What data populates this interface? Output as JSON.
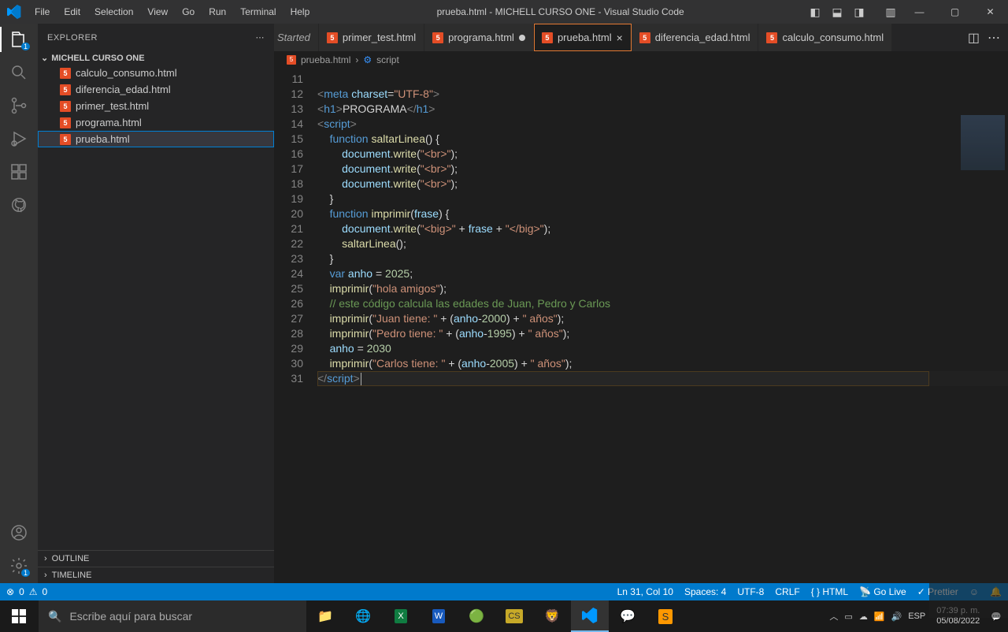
{
  "titlebar": {
    "menus": [
      "File",
      "Edit",
      "Selection",
      "View",
      "Go",
      "Run",
      "Terminal",
      "Help"
    ],
    "title": "prueba.html - MICHELL CURSO ONE - Visual Studio Code"
  },
  "sidebar": {
    "title": "EXPLORER",
    "folder": "MICHELL CURSO ONE",
    "files": [
      "calculo_consumo.html",
      "diferencia_edad.html",
      "primer_test.html",
      "programa.html",
      "prueba.html"
    ],
    "selected_index": 4,
    "outline": "OUTLINE",
    "timeline": "TIMELINE"
  },
  "tabs": {
    "partial": "Started",
    "items": [
      {
        "label": "primer_test.html",
        "dirty": false,
        "active": false
      },
      {
        "label": "programa.html",
        "dirty": true,
        "active": false
      },
      {
        "label": "prueba.html",
        "dirty": false,
        "active": true
      },
      {
        "label": "diferencia_edad.html",
        "dirty": false,
        "active": false
      },
      {
        "label": "calculo_consumo.html",
        "dirty": false,
        "active": false
      }
    ]
  },
  "breadcrumb": {
    "file": "prueba.html",
    "sym": "script"
  },
  "code": {
    "first_line": 11
  },
  "statusbar": {
    "errors": "0",
    "warnings": "0",
    "pos": "Ln 31, Col 10",
    "spaces": "Spaces: 4",
    "enc": "UTF-8",
    "eol": "CRLF",
    "lang": "HTML",
    "golive": "Go Live",
    "prettier": "Prettier"
  },
  "taskbar": {
    "search_placeholder": "Escribe aquí para buscar",
    "time": "07:39 p. m.",
    "date": "05/08/2022"
  }
}
